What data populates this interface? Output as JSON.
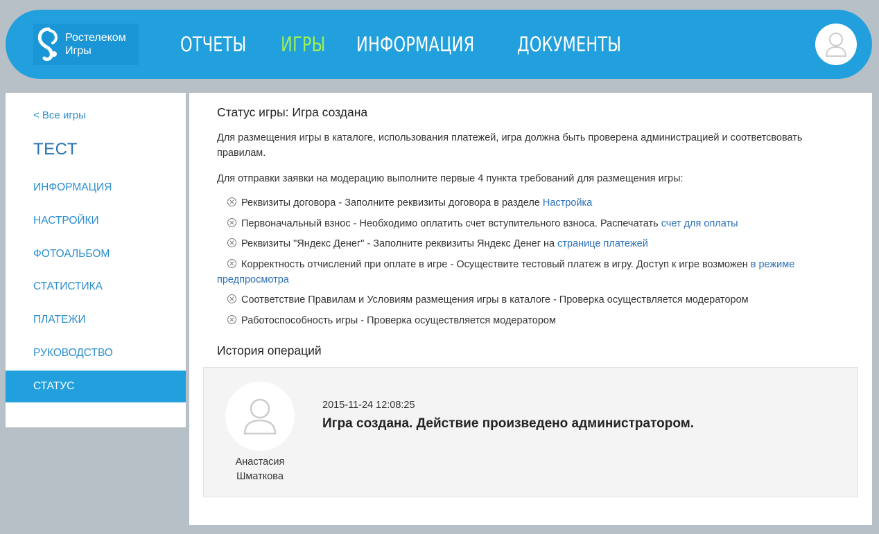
{
  "header": {
    "logo_line1": "Ростелеком",
    "logo_line2": "Игры",
    "nav": [
      "ОТЧЕТЫ",
      "ИГРЫ",
      "ИНФОРМАЦИЯ",
      "ДОКУМЕНТЫ"
    ],
    "active_nav": "ИГРЫ"
  },
  "sidebar": {
    "back_label": "< Все игры",
    "game_title": "ТЕСТ",
    "items": [
      "ИНФОРМАЦИЯ",
      "НАСТРОЙКИ",
      "ФОТОАЛЬБОМ",
      "СТАТИСТИКА",
      "ПЛАТЕЖИ",
      "РУКОВОДСТВО",
      "СТАТУС"
    ],
    "active_item": "СТАТУС"
  },
  "main": {
    "status_title": "Статус игры: Игра создана",
    "para1": "Для размещения игры в каталоге, использования платежей, игра должна быть проверена администрацией и соответсвовать правилам.",
    "para2": "Для отправки заявки на модерацию выполните первые 4 пункта требований для размещения игры:",
    "requirements": [
      {
        "text": "Реквизиты договора - Заполните реквизиты договора в разделе ",
        "link": "Настройка"
      },
      {
        "text": "Первоначальный взнос - Необходимо оплатить счет вступительного взноса. Распечатать ",
        "link": "счет для оплаты"
      },
      {
        "text": "Реквизиты \"Яндекс Денег\" - Заполните реквизиты Яндекс Денег на ",
        "link": "странице платежей"
      },
      {
        "text": "Корректность отчислений при оплате в игре - Осуществите тестовый платеж в игру. Доступ к игре возможен ",
        "link": "в режиме предпросмотра"
      },
      {
        "text": "Соответствие Правилам и Условиям размещения игры в каталоге - Проверка осуществляется модератором",
        "link": ""
      },
      {
        "text": "Работоспособность игры - Проверка осуществляется модератором",
        "link": ""
      }
    ],
    "history_title": "История операций",
    "history": {
      "user_name": "Анастасия Шматкова",
      "date": "2015-11-24 12:08:25",
      "message": "Игра создана. Действие произведено администратором."
    }
  },
  "colors": {
    "header_bg": "#22a0dd",
    "active_nav": "#9fef56",
    "link": "#2a8fd0",
    "page_bg": "#b7c0c6"
  }
}
